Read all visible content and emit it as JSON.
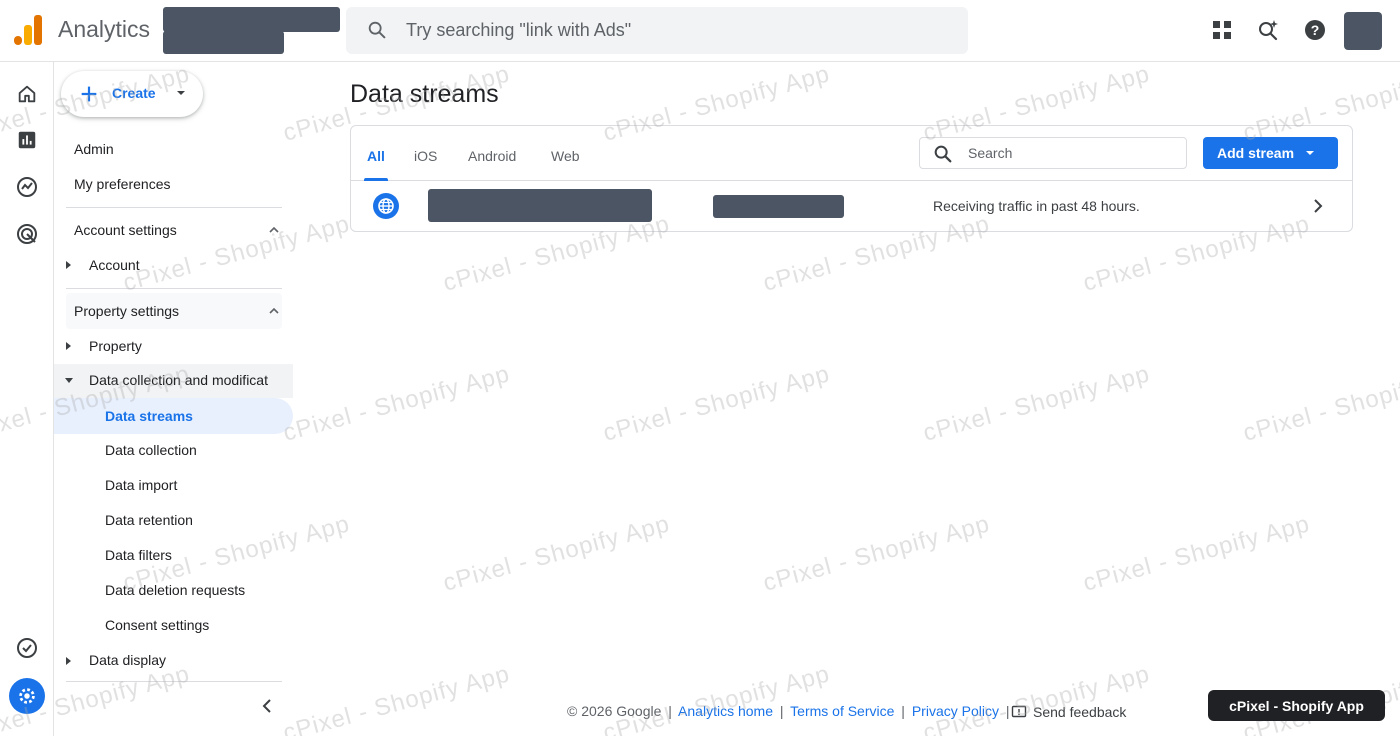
{
  "app": {
    "name": "Analytics"
  },
  "search": {
    "placeholder": "Try searching \"link with Ads\""
  },
  "rail": {
    "icons": [
      "home-icon",
      "reports-icon",
      "explore-icon",
      "advertising-icon",
      "insights-icon",
      "admin-gear-icon"
    ]
  },
  "nav": {
    "create_label": "Create",
    "admin": "Admin",
    "my_preferences": "My preferences",
    "account_settings": "Account settings",
    "account": "Account",
    "property_settings": "Property settings",
    "property": "Property",
    "data_collection_mod": "Data collection and modificat",
    "sub_items": [
      "Data streams",
      "Data collection",
      "Data import",
      "Data retention",
      "Data filters",
      "Data deletion requests",
      "Consent settings"
    ],
    "data_display": "Data display"
  },
  "main": {
    "title": "Data streams",
    "tabs": [
      "All",
      "iOS",
      "Android",
      "Web"
    ],
    "active_tab": "All",
    "search_placeholder": "Search",
    "add_stream_label": "Add stream",
    "stream": {
      "status": "Receiving traffic in past 48 hours."
    }
  },
  "footer": {
    "copyright": "© 2026 Google",
    "links": [
      "Analytics home",
      "Terms of Service",
      "Privacy Policy"
    ],
    "feedback": "Send feedback"
  },
  "watermark": {
    "text": "cPixel - Shopify App",
    "badge": "cPixel - Shopify App"
  },
  "colors": {
    "accent": "#1a73e8",
    "redaction": "#4b5563",
    "logo_orange": "#e37400",
    "logo_yellow": "#f9ab00"
  }
}
